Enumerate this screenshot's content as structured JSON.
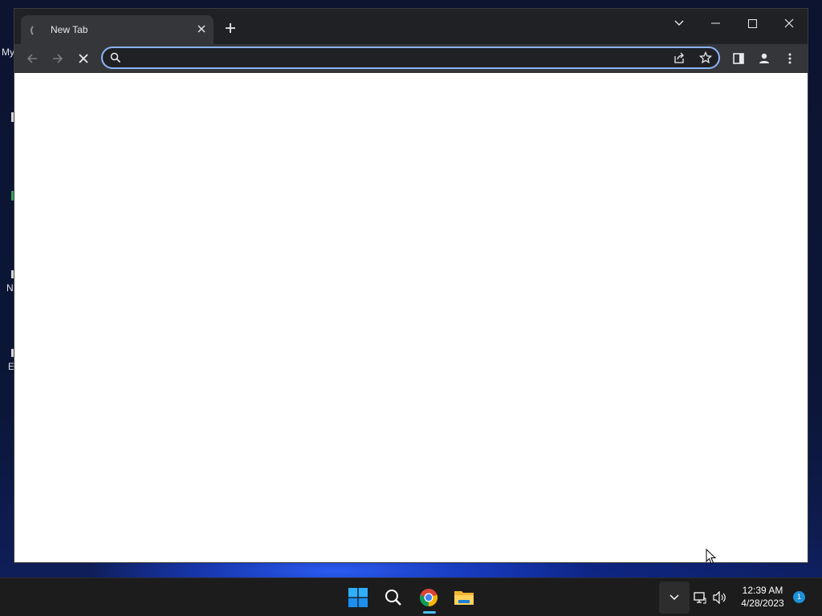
{
  "desktop": {
    "partial_labels": [
      "My",
      "N",
      "E"
    ]
  },
  "browser": {
    "tab": {
      "title": "New Tab",
      "loading": true
    },
    "new_tab_icon": "plus-icon",
    "tab_search_icon": "chevron-down-icon",
    "window_controls": [
      "minimize-icon",
      "maximize-icon",
      "close-icon"
    ],
    "toolbar": {
      "back_icon": "arrow-left-icon",
      "forward_icon": "arrow-right-icon",
      "stop_icon": "x-icon",
      "omnibox": {
        "value": "",
        "placeholder": ""
      },
      "actions": [
        "share-icon",
        "star-icon",
        "side-panel-icon",
        "profile-icon",
        "kebab-menu-icon"
      ]
    },
    "accent": "#8ab4f8"
  },
  "taskbar": {
    "apps": [
      "windows-start-icon",
      "search-icon",
      "chrome-icon",
      "file-explorer-icon"
    ],
    "active_app": "chrome-icon",
    "tray": {
      "chevron": "chevron-up-icon",
      "icons": [
        "network-icon",
        "volume-icon"
      ]
    },
    "time": "12:39 AM",
    "date": "4/28/2023",
    "notification_count": "1"
  }
}
